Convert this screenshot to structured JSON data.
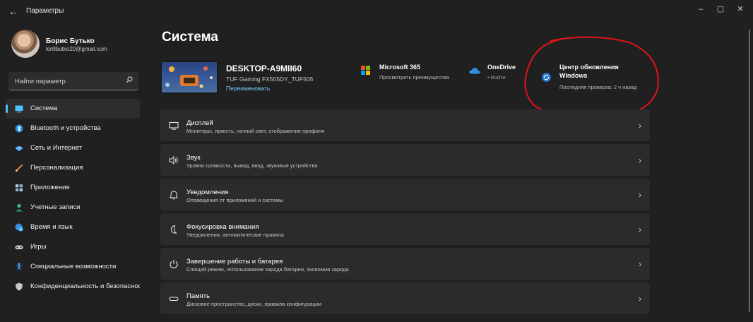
{
  "window": {
    "title": "Параметры",
    "back_glyph": "←",
    "minimize_glyph": "–",
    "maximize_glyph": "▢",
    "close_glyph": "✕"
  },
  "profile": {
    "name": "Борис Бутько",
    "email": "kirillbutko20@gmail.com"
  },
  "search": {
    "placeholder": "Найти параметр",
    "icon": "search-icon"
  },
  "sidebar": {
    "items": [
      {
        "label": "Система",
        "icon": "monitor-icon",
        "active": true
      },
      {
        "label": "Bluetooth и устройства",
        "icon": "bluetooth-icon"
      },
      {
        "label": "Сеть и Интернет",
        "icon": "wifi-icon"
      },
      {
        "label": "Персонализация",
        "icon": "brush-icon"
      },
      {
        "label": "Приложения",
        "icon": "apps-icon"
      },
      {
        "label": "Учетные записи",
        "icon": "person-icon"
      },
      {
        "label": "Время и язык",
        "icon": "globe-clock-icon"
      },
      {
        "label": "Игры",
        "icon": "gamepad-icon"
      },
      {
        "label": "Специальные возможности",
        "icon": "accessibility-icon"
      },
      {
        "label": "Конфиденциальность и безопасность",
        "icon": "shield-icon"
      }
    ]
  },
  "main": {
    "title": "Система",
    "device": {
      "name": "DESKTOP-A9MII60",
      "model": "TUF Gaming FX505DY_TUF505",
      "rename_label": "Переименовать"
    },
    "quick_access": [
      {
        "title": "Microsoft 365",
        "subtitle": "Просмотреть преимущества",
        "icon": "microsoft-logo-icon"
      },
      {
        "title": "OneDrive",
        "subtitle": "• Войти",
        "icon": "cloud-icon"
      },
      {
        "title": "Центр обновления Windows",
        "title_line1": "Центр обновления",
        "title_line2": "Windows",
        "subtitle": "Последняя проверка: 2 ч назад",
        "icon": "sync-icon"
      }
    ],
    "settings": [
      {
        "title": "Дисплей",
        "subtitle": "Мониторы, яркость, ночной свет, отображение профиля",
        "icon": "display-icon"
      },
      {
        "title": "Звук",
        "subtitle": "Уровни громкости, вывод, ввод, звуковые устройства",
        "icon": "speaker-icon"
      },
      {
        "title": "Уведомления",
        "subtitle": "Оповещения от приложений и системы",
        "icon": "bell-icon"
      },
      {
        "title": "Фокусировка внимания",
        "subtitle": "Уведомления, автоматические правила",
        "icon": "moon-icon"
      },
      {
        "title": "Завершение работы и батарея",
        "subtitle": "Спящий режим, использование заряда батареи, экономия заряда",
        "icon": "power-icon"
      },
      {
        "title": "Память",
        "subtitle": "Дисковое пространство, диски, правила конфигурации",
        "icon": "storage-icon"
      }
    ],
    "chevron_glyph": "›"
  },
  "colors": {
    "accent": "#4cc2ff",
    "annotation": "#e0141b",
    "background": "#202020",
    "card": "#2b2b2b"
  }
}
